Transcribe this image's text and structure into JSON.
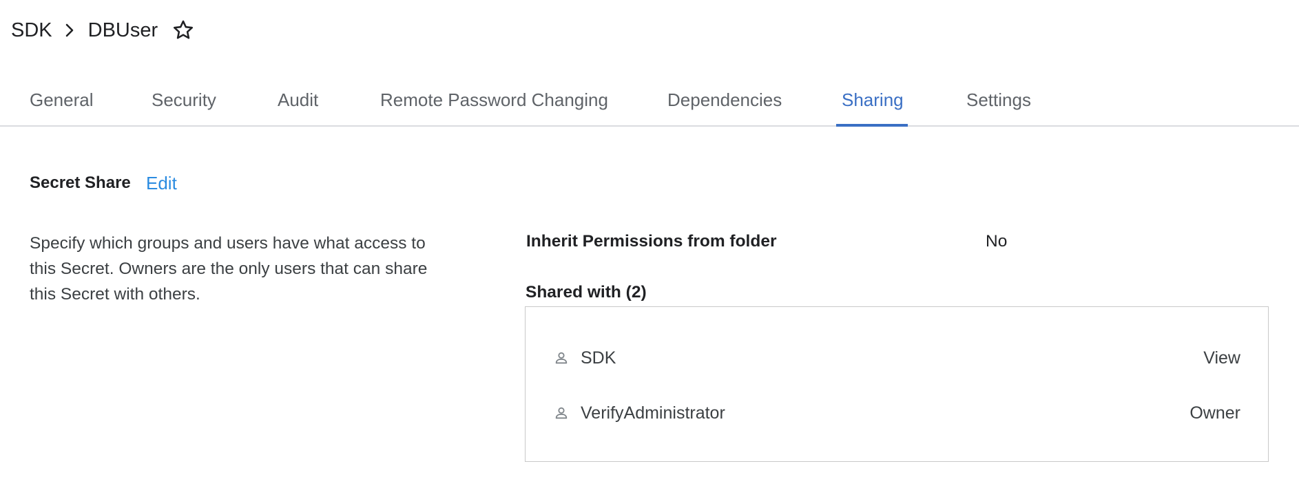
{
  "breadcrumb": {
    "parent": "SDK",
    "current": "DBUser"
  },
  "tabs": [
    {
      "label": "General"
    },
    {
      "label": "Security"
    },
    {
      "label": "Audit"
    },
    {
      "label": "Remote Password Changing"
    },
    {
      "label": "Dependencies"
    },
    {
      "label": "Sharing",
      "active": true
    },
    {
      "label": "Settings"
    }
  ],
  "section": {
    "title": "Secret Share",
    "edit_label": "Edit",
    "description": "Specify which groups and users have what access to this Secret. Owners are the only users that can share this Secret with others.",
    "inherit_label": "Inherit Permissions from folder",
    "inherit_value": "No"
  },
  "shared": {
    "title": "Shared with (2)",
    "entries": [
      {
        "name": "SDK",
        "permission": "View",
        "icon": "user-icon"
      },
      {
        "name": "VerifyAdministrator",
        "permission": "Owner",
        "icon": "user-icon"
      }
    ]
  },
  "colors": {
    "accent": "#3a6fc4",
    "link": "#2a8be0"
  }
}
